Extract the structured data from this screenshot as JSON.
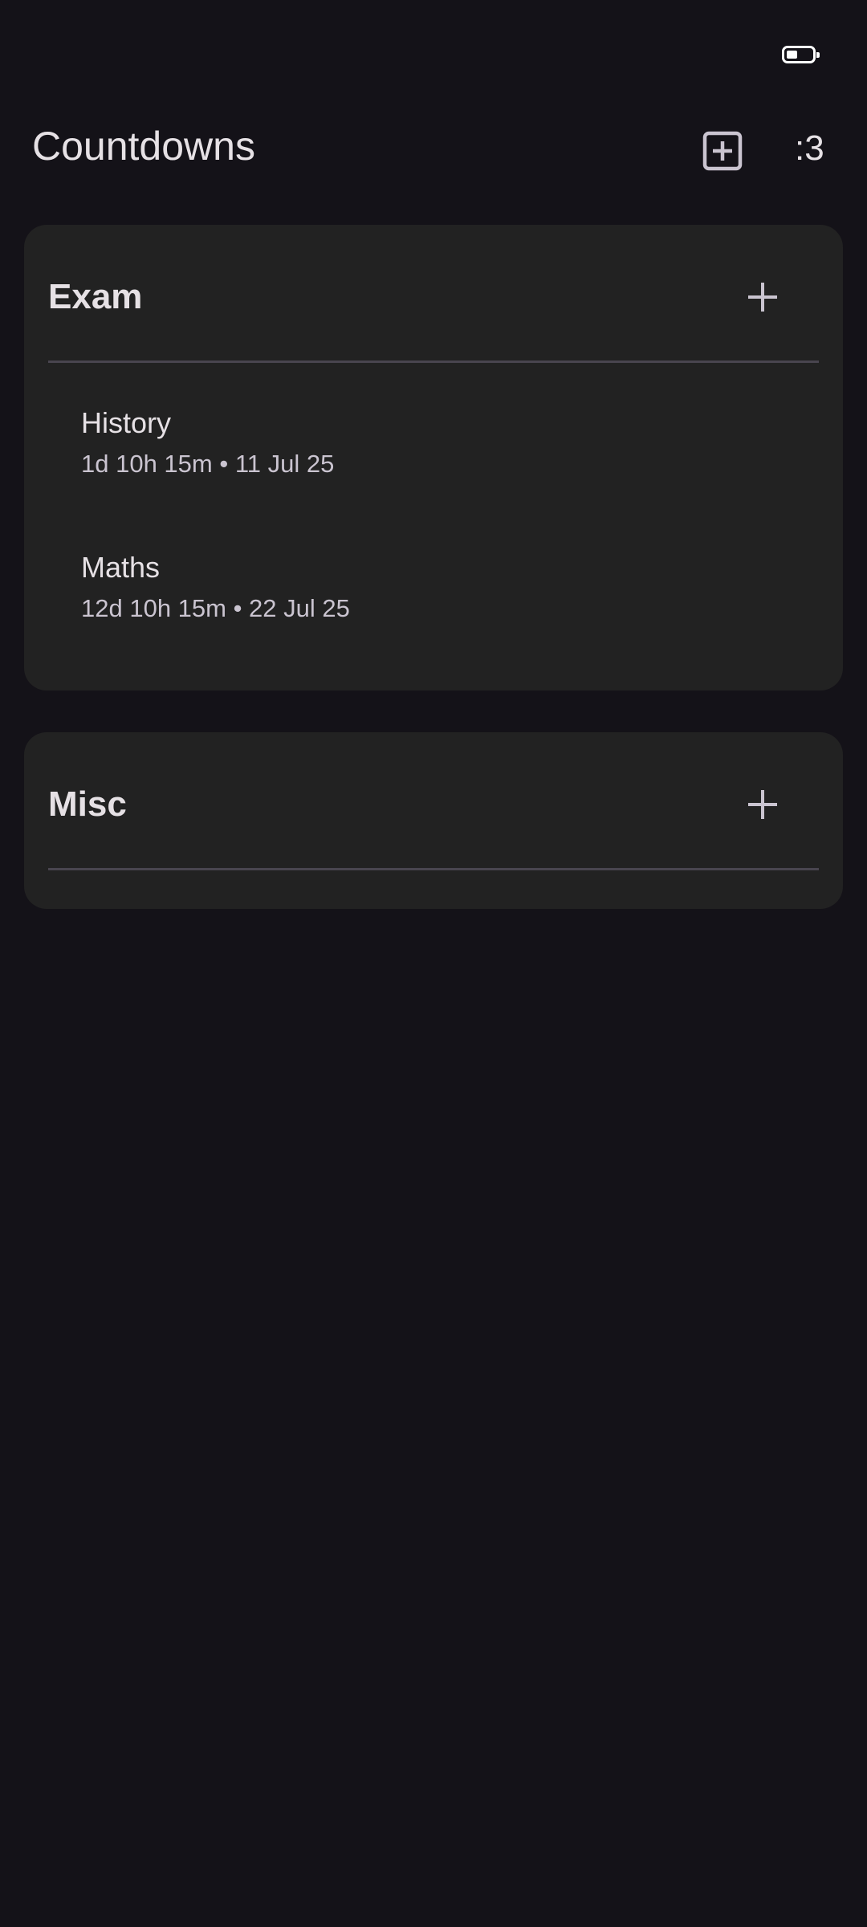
{
  "app_bar": {
    "title": "Countdowns",
    "add_icon": "add-box-icon",
    "menu_label": ":3"
  },
  "groups": [
    {
      "name": "Exam",
      "add_icon": "plus-icon",
      "items": [
        {
          "title": "History",
          "subtitle": "1d 10h 15m • 11 Jul 25"
        },
        {
          "title": "Maths",
          "subtitle": "12d 10h 15m • 22 Jul 25"
        }
      ]
    },
    {
      "name": "Misc",
      "add_icon": "plus-icon",
      "items": []
    }
  ],
  "colors": {
    "background": "#141218",
    "card": "#222222",
    "text": "#E6E1E5",
    "subtext": "#CAC4D0",
    "divider": "#49454F"
  }
}
